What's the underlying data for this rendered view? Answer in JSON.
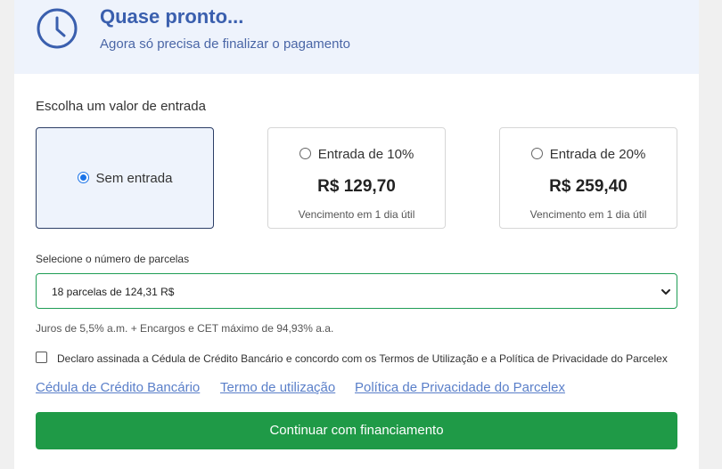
{
  "header": {
    "title": "Quase pronto...",
    "subtitle": "Agora só precisa de finalizar o pagamento",
    "icon": "clock-icon",
    "accent_color": "#3a5fae"
  },
  "down_payment": {
    "label": "Escolha um valor de entrada",
    "options": [
      {
        "label": "Sem entrada",
        "selected": true
      },
      {
        "label": "Entrada de 10%",
        "price": "R$ 129,70",
        "note": "Vencimento em 1 dia útil",
        "selected": false
      },
      {
        "label": "Entrada de 20%",
        "price": "R$ 259,40",
        "note": "Vencimento em 1 dia útil",
        "selected": false
      }
    ]
  },
  "installments": {
    "label": "Selecione o número de parcelas",
    "selected_value": "18 parcelas de 124,31 R$",
    "interest_note": "Juros de 5,5% a.m. + Encargos e CET máximo de 94,93% a.a."
  },
  "agreement": {
    "checked": false,
    "text": "Declaro assinada a Cédula de Crédito Bancário e concordo com os Termos de Utilização e a Política de Privacidade do Parcelex"
  },
  "links": [
    "Cédula de Crédito Bancário",
    "Termo de utilização",
    "Política de Privacidade do Parcelex"
  ],
  "continue_button": {
    "label": "Continuar com financiamento",
    "color": "#1f9a47"
  }
}
